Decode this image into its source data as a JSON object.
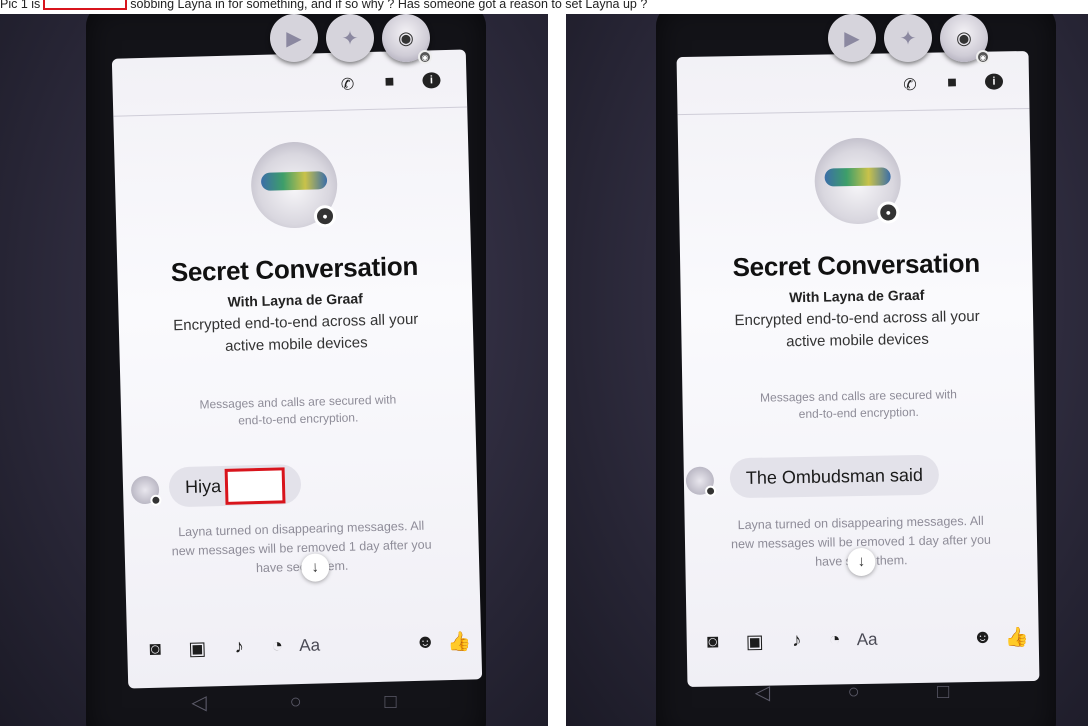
{
  "caption": {
    "before": "Pic 1 is",
    "after": "sobbing Layna in for something, and if so why ? Has someone got a reason to set Layna up ?"
  },
  "chat_heads": [
    "▶",
    "✦",
    "◉"
  ],
  "header_icons": {
    "call": "phone-icon",
    "video": "video-camera-icon",
    "info": "info-icon"
  },
  "conversation": {
    "title": "Secret Conversation",
    "with": "With Layna de Graaf",
    "encrypted_line1": "Encrypted end-to-end across all your",
    "encrypted_line2": "active mobile devices",
    "secured_line1": "Messages and calls are secured with",
    "secured_line2": "end-to-end encryption."
  },
  "left": {
    "message": "Hiya"
  },
  "right": {
    "message": "The Ombudsman said"
  },
  "disappearing": {
    "line1": "Layna turned on disappearing messages. All",
    "line2": "new messages will be removed 1 day after you",
    "line3": "have seen them."
  },
  "composer": {
    "placeholder": "Aa",
    "icons": [
      "camera-icon",
      "image-icon",
      "microphone-icon",
      "timer-icon",
      "emoji-icon",
      "thumbs-up-icon"
    ]
  },
  "navbar": {
    "back": "◁",
    "home": "○",
    "recents": "□"
  }
}
